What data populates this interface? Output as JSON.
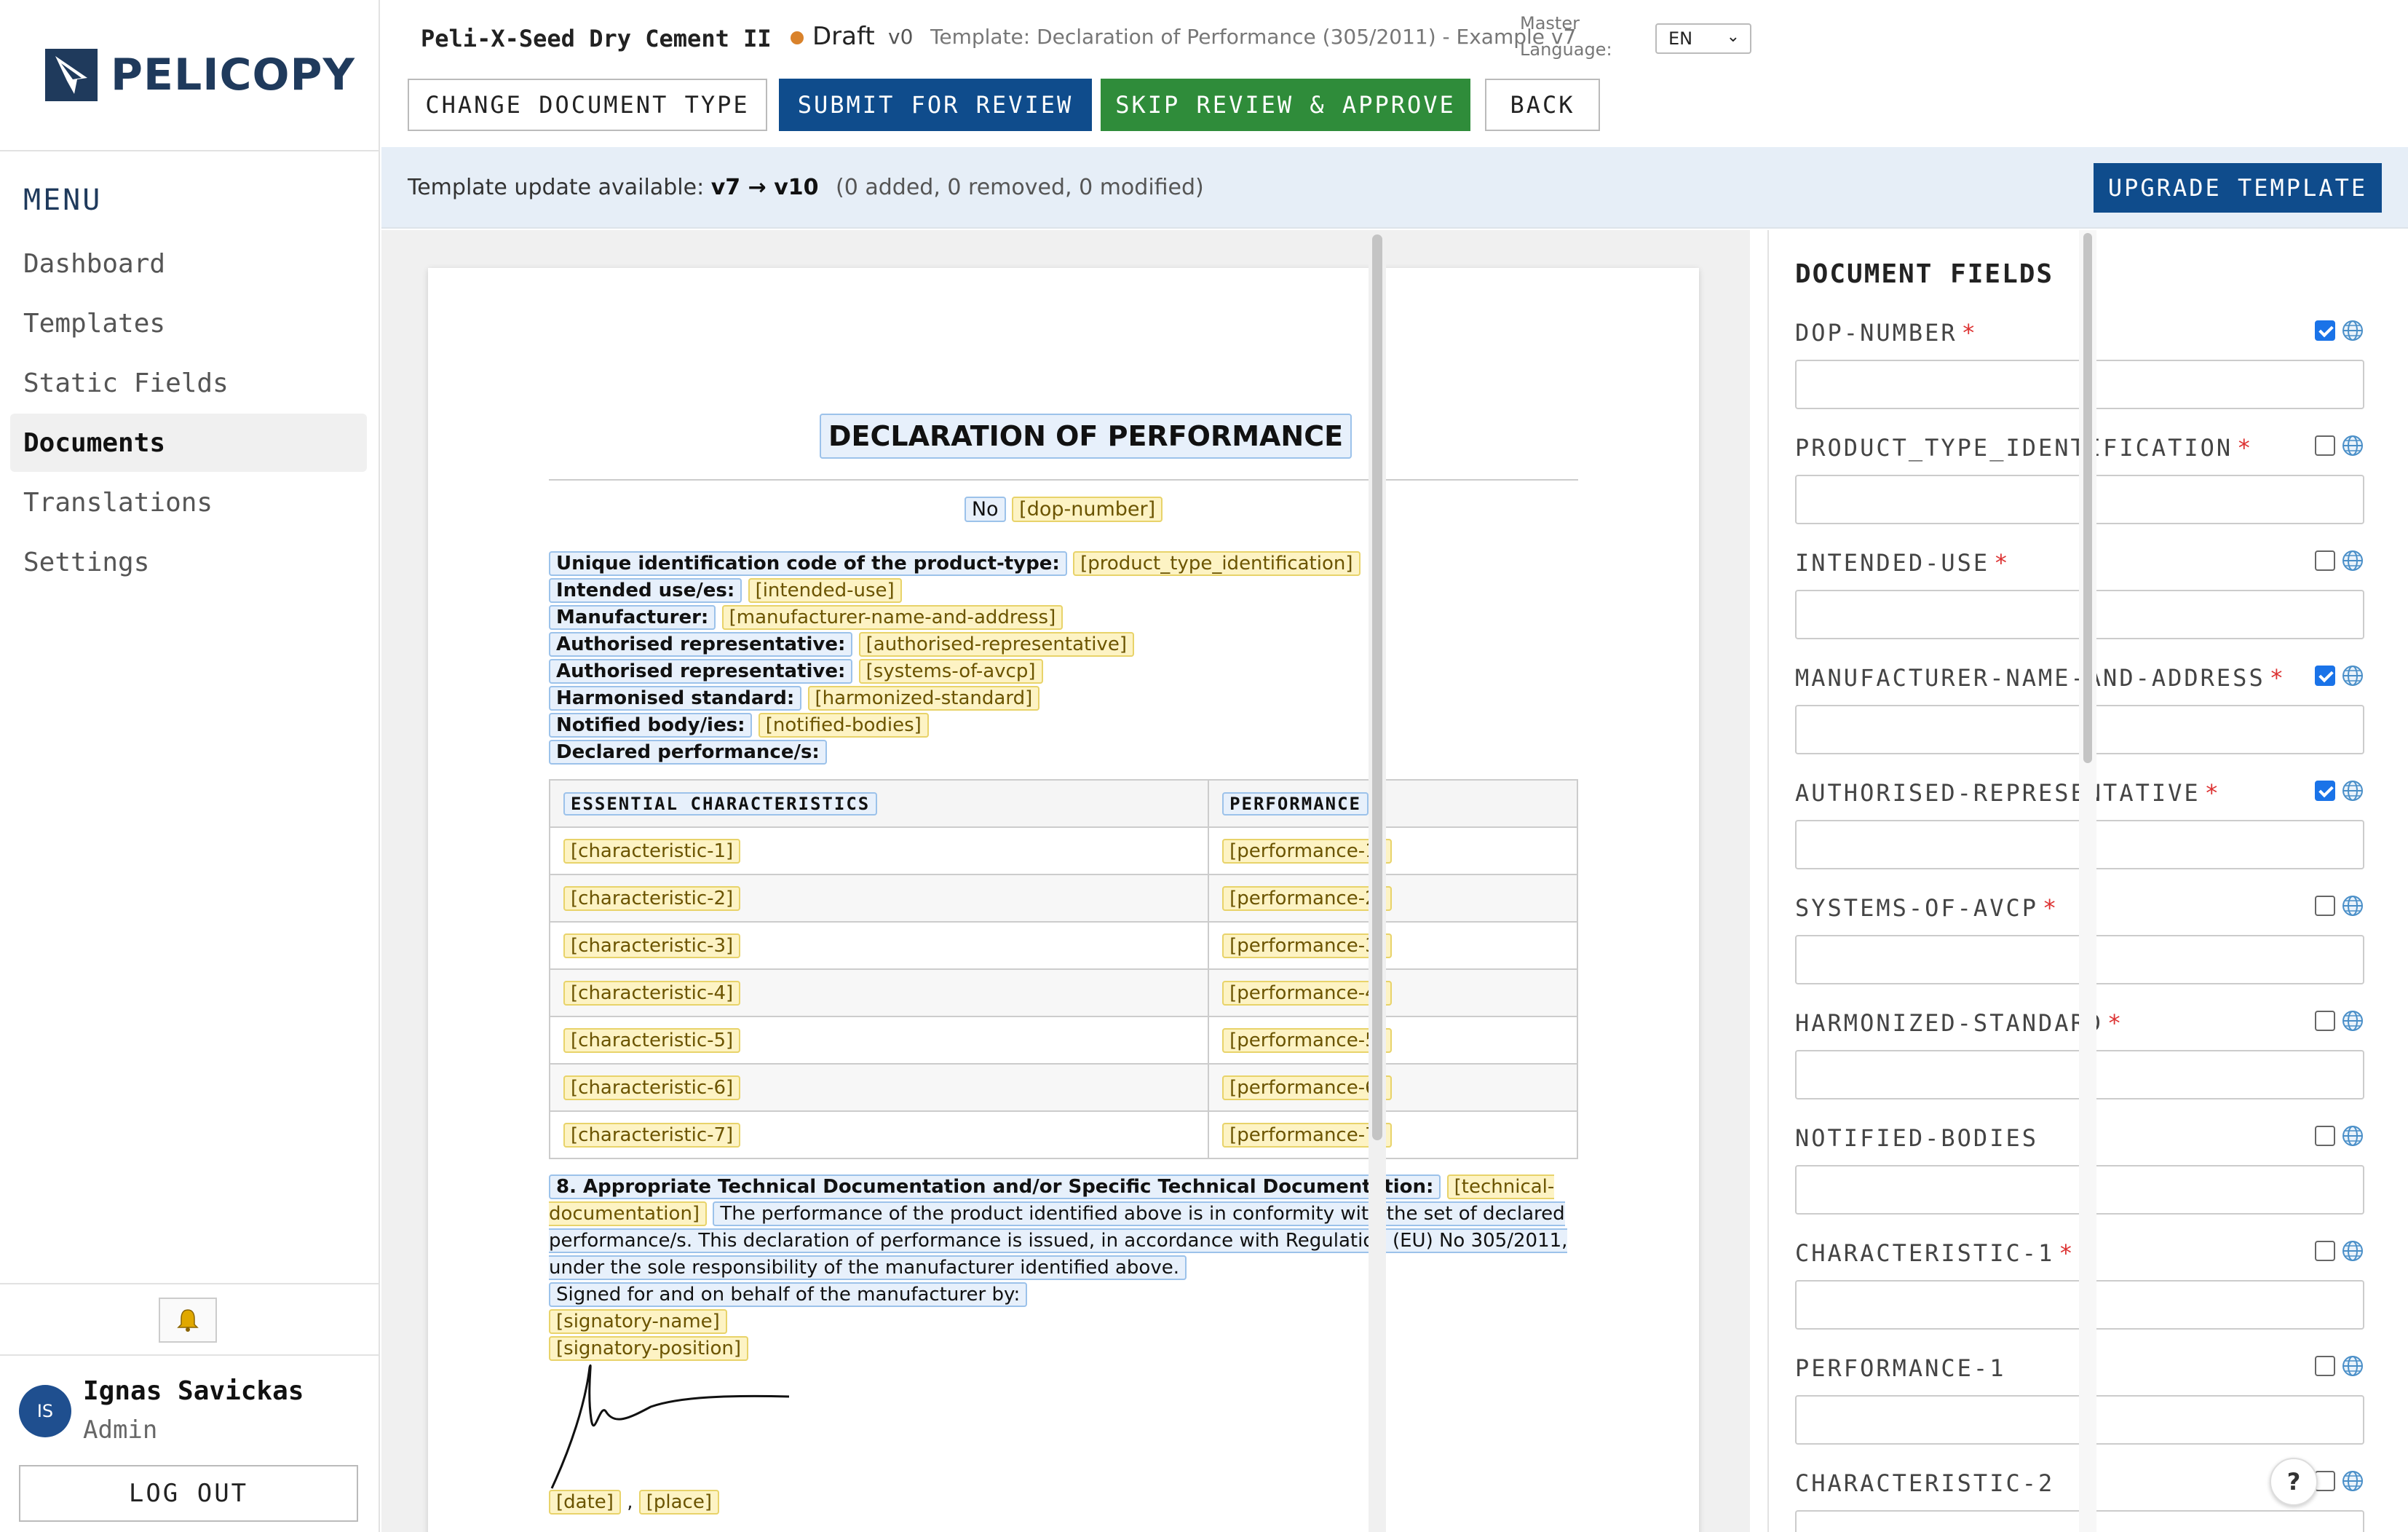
{
  "brand": {
    "name": "PELICOPY"
  },
  "menu": {
    "title": "MENU",
    "items": [
      {
        "label": "Dashboard",
        "active": false
      },
      {
        "label": "Templates",
        "active": false
      },
      {
        "label": "Static Fields",
        "active": false
      },
      {
        "label": "Documents",
        "active": true
      },
      {
        "label": "Translations",
        "active": false
      },
      {
        "label": "Settings",
        "active": false
      }
    ]
  },
  "user": {
    "initials": "IS",
    "name": "Ignas Savickas",
    "role": "Admin",
    "logout_label": "LOG OUT"
  },
  "header": {
    "doc_name": "Peli-X-Seed Dry Cement II",
    "status": "Draft",
    "status_color": "#d9822b",
    "version": "v0",
    "template_info": "Template: Declaration of Performance (305/2011) - Example v7",
    "master_language_label": "Master Language:",
    "master_language_value": "EN"
  },
  "toolbar": {
    "change_type": "CHANGE DOCUMENT TYPE",
    "submit": "SUBMIT FOR REVIEW",
    "skip": "SKIP REVIEW & APPROVE",
    "back": "BACK"
  },
  "banner": {
    "prefix": "Template update available:",
    "versions": "v7 → v10",
    "details": "(0 added, 0 removed, 0 modified)",
    "upgrade_label": "UPGRADE TEMPLATE"
  },
  "document": {
    "title": "DECLARATION OF PERFORMANCE",
    "no_label": "No",
    "no_tag": "[dop-number]",
    "rows": [
      {
        "label": "Unique identification code of the product-type:",
        "tag": "[product_type_identification]"
      },
      {
        "label": "Intended use/es:",
        "tag": "[intended-use]"
      },
      {
        "label": "Manufacturer:",
        "tag": "[manufacturer-name-and-address]"
      },
      {
        "label": "Authorised representative:",
        "tag": "[authorised-representative]"
      },
      {
        "label": "Authorised representative:",
        "tag": "[systems-of-avcp]"
      },
      {
        "label": "Harmonised standard:",
        "tag": "[harmonized-standard]"
      },
      {
        "label": "Notified body/ies:",
        "tag": "[notified-bodies]"
      },
      {
        "label": "Declared performance/s:",
        "tag": ""
      }
    ],
    "table_headers": [
      "ESSENTIAL CHARACTERISTICS",
      "PERFORMANCE"
    ],
    "table_rows": [
      [
        "[characteristic-1]",
        "[performance-1]"
      ],
      [
        "[characteristic-2]",
        "[performance-2]"
      ],
      [
        "[characteristic-3]",
        "[performance-3]"
      ],
      [
        "[characteristic-4]",
        "[performance-4]"
      ],
      [
        "[characteristic-5]",
        "[performance-5]"
      ],
      [
        "[characteristic-6]",
        "[performance-6]"
      ],
      [
        "[characteristic-7]",
        "[performance-7]"
      ]
    ],
    "tech_label": "8. Appropriate Technical Documentation and/or Specific Technical Documentation:",
    "tech_tag": "[technical-documentation]",
    "conformity_text": "The performance of the product identified above is in conformity with the set of declared performance/s. This declaration of performance is issued, in accordance with Regulation (EU) No 305/2011, under the sole responsibility of the manufacturer identified above.",
    "signed_text": "Signed for and on behalf of the manufacturer by:",
    "signatory_name": "[signatory-name]",
    "signatory_position": "[signatory-position]",
    "date_tag": "[date]",
    "date_sep": ",",
    "place_tag": "[place]"
  },
  "fields_panel": {
    "title": "DOCUMENT FIELDS",
    "fields": [
      {
        "name": "DOP-NUMBER",
        "required": true,
        "checked": true
      },
      {
        "name": "PRODUCT_TYPE_IDENTIFICATION",
        "required": true,
        "checked": false
      },
      {
        "name": "INTENDED-USE",
        "required": true,
        "checked": false
      },
      {
        "name": "MANUFACTURER-NAME-AND-ADDRESS",
        "required": true,
        "checked": true
      },
      {
        "name": "AUTHORISED-REPRESENTATIVE",
        "required": true,
        "checked": true
      },
      {
        "name": "SYSTEMS-OF-AVCP",
        "required": true,
        "checked": false
      },
      {
        "name": "HARMONIZED-STANDARD",
        "required": true,
        "checked": false
      },
      {
        "name": "NOTIFIED-BODIES",
        "required": false,
        "checked": false
      },
      {
        "name": "CHARACTERISTIC-1",
        "required": true,
        "checked": false
      },
      {
        "name": "PERFORMANCE-1",
        "required": false,
        "checked": false
      },
      {
        "name": "CHARACTERISTIC-2",
        "required": false,
        "checked": false
      }
    ]
  },
  "help_label": "?",
  "icons": {
    "bell": "bell-icon",
    "globe": "globe-icon",
    "logo": "pelican-logo-icon",
    "help": "help-icon"
  },
  "colors": {
    "brand": "#1f3a5c",
    "primary": "#0f4c8c",
    "success": "#2f8c3a",
    "required": "#d33"
  }
}
